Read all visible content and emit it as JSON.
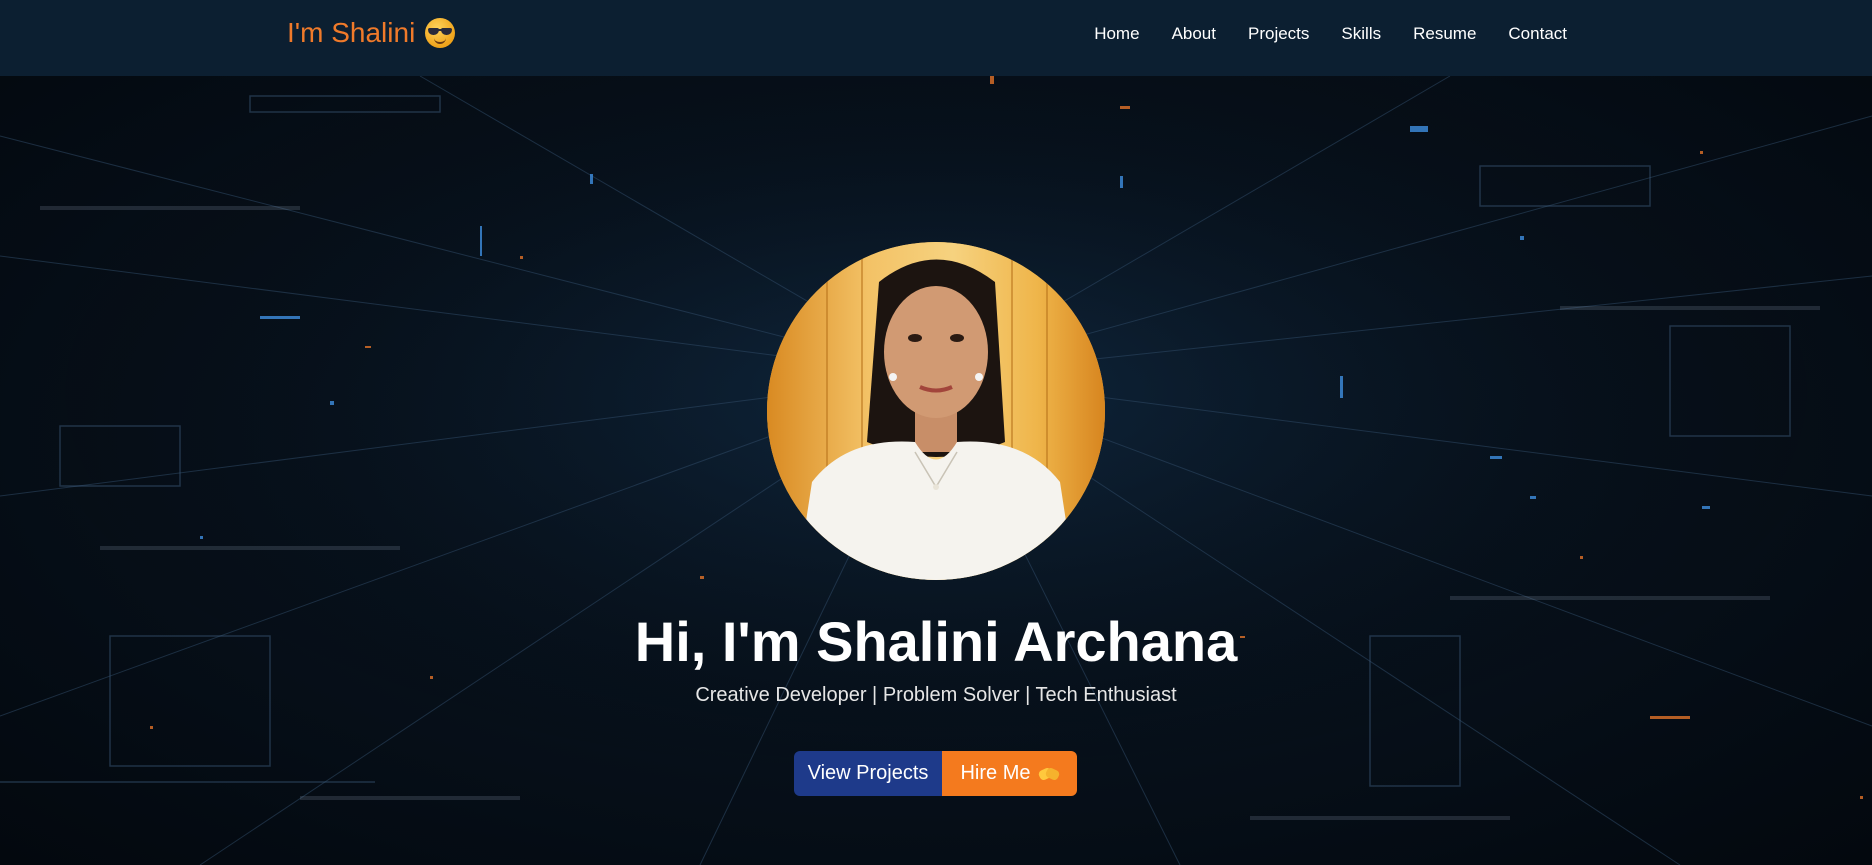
{
  "brand": {
    "name": "I'm Shalini",
    "emoji_icon": "sunglasses-smiley-icon"
  },
  "nav": {
    "items": [
      "Home",
      "About",
      "Projects",
      "Skills",
      "Resume",
      "Contact"
    ]
  },
  "hero": {
    "headline": "Hi, I'm Shalini Archana",
    "tagline": "Creative Developer | Problem Solver | Tech Enthusiast",
    "buttons": {
      "view_projects": "View Projects",
      "hire_me": "Hire Me",
      "hire_me_icon": "handshake-icon"
    }
  },
  "colors": {
    "navbar": "#0c1f31",
    "brand": "#f07a2a",
    "primary_button": "#1e3a8a",
    "accent_button": "#f47a1e"
  }
}
